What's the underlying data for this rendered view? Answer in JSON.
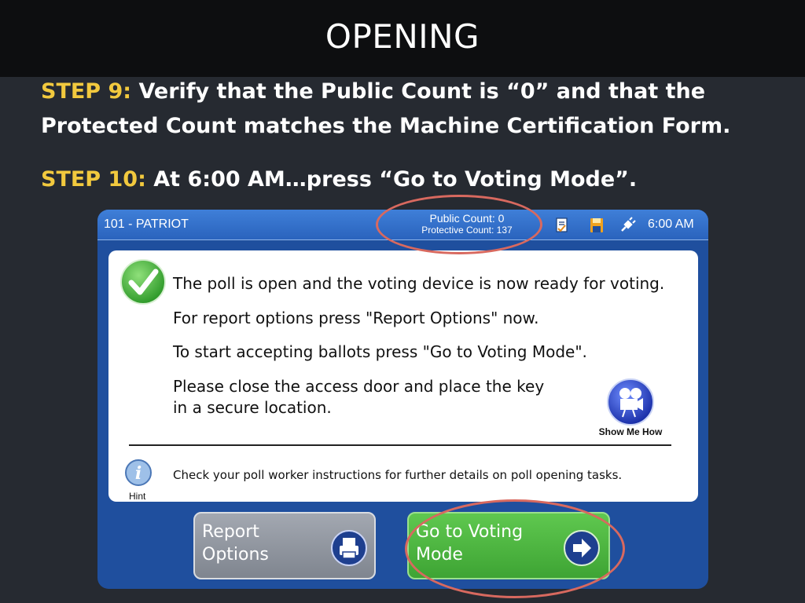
{
  "slide": {
    "title": "OPENING",
    "step9": {
      "label": "STEP 9:",
      "line1": "Verify that the Public Count is “0” and that the",
      "line2": "Protected Count matches the Machine Certification Form."
    },
    "step10": {
      "label": "STEP 10:",
      "text": "At 6:00 AM…press “Go to Voting Mode”."
    }
  },
  "screen": {
    "titlebar": {
      "name": "101 - PATRIOT",
      "public_count": "Public Count: 0",
      "protective_count": "Protective Count: 137",
      "icons": [
        "report-document-icon",
        "save-memory-card-icon",
        "power-plug-icon"
      ],
      "time": "6:00 AM"
    },
    "messages": [
      "The poll is open and the voting device is now ready for voting.",
      "For report options press \"Report Options\" now.",
      "To start accepting ballots press \"Go to Voting Mode\".",
      "Please close the access door and place the key",
      "in a secure location."
    ],
    "show_me_how": "Show Me How",
    "hint": {
      "label": "Hint",
      "text": "Check your poll worker instructions for further details on poll opening tasks."
    },
    "buttons": {
      "report_line1": "Report",
      "report_line2": "Options",
      "voting_line1": "Go to Voting",
      "voting_line2": "Mode"
    }
  },
  "colors": {
    "step_label": "#f2c93e",
    "panel_blue": "#1f4f9e",
    "voting_green": "#4cb83f",
    "highlight_circle": "#d8695f"
  }
}
